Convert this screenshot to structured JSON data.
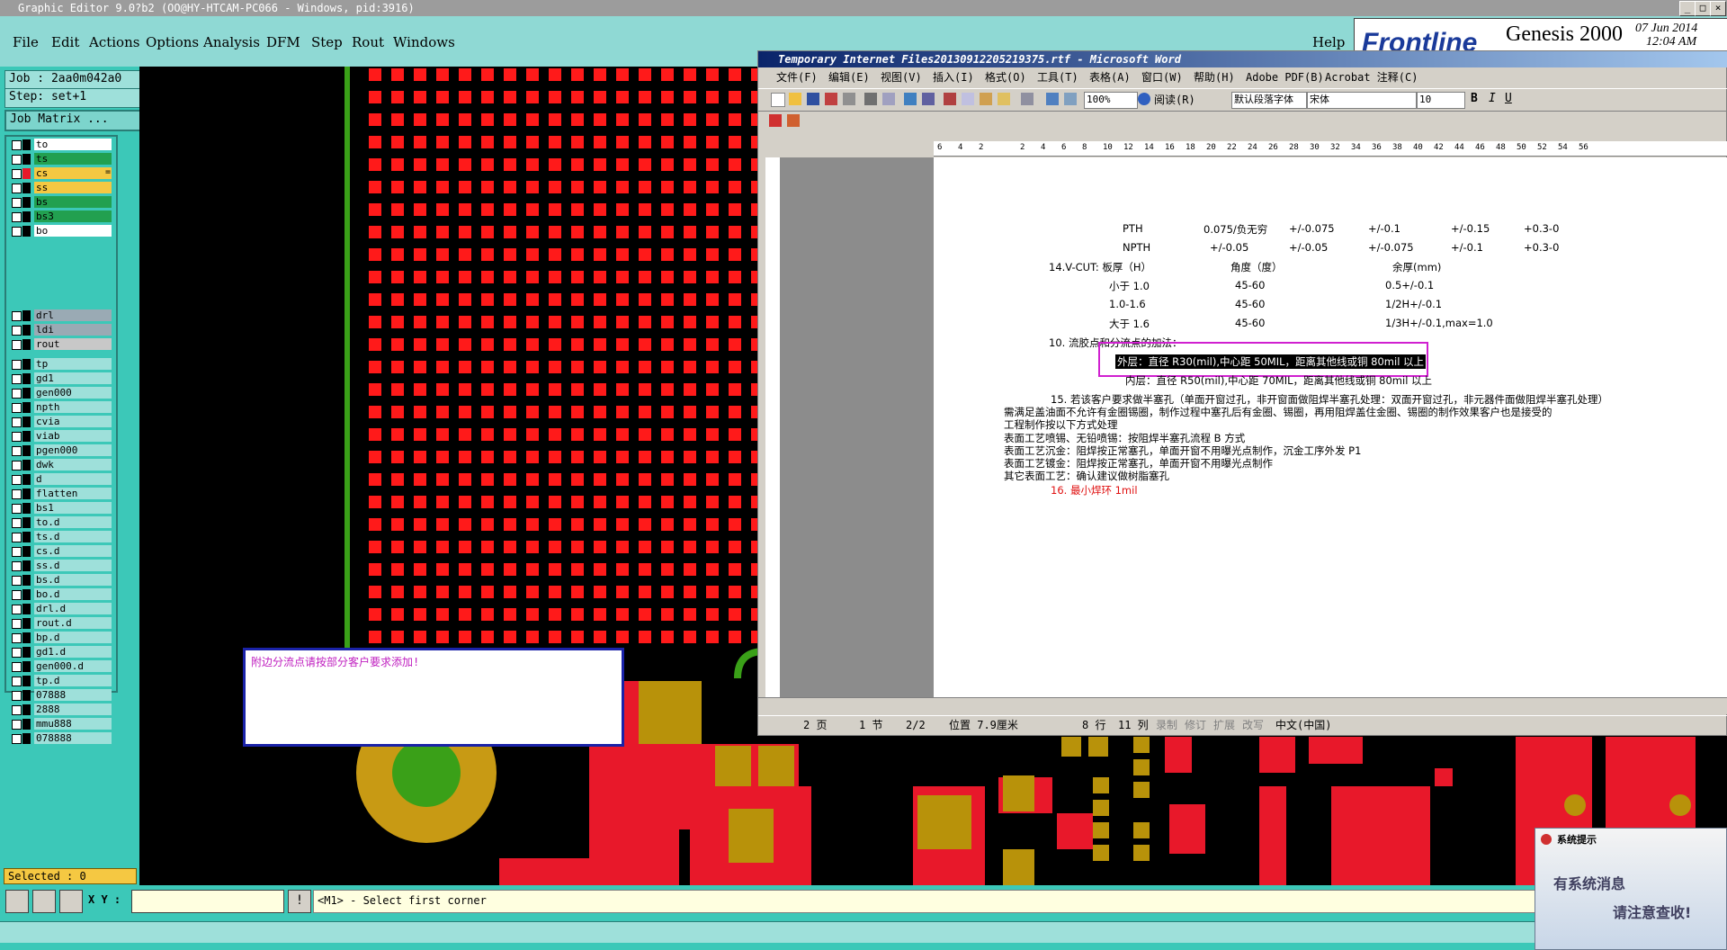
{
  "genesis": {
    "title": "Graphic Editor 9.0?b2 (OO@HY-HTCAM-PC066 - Windows, pid:3916)",
    "menus": [
      "File",
      "Edit",
      "Actions",
      "Options",
      "Analysis",
      "DFM",
      "Step",
      "Rout",
      "Windows"
    ],
    "help": "Help",
    "brand": "Frontline",
    "product": "Genesis 2000",
    "date": "07 Jun 2014",
    "time": "12:04 AM",
    "job": "Job : 2aa0m042a0",
    "step": "Step: set+1",
    "job_matrix": "Job Matrix ...",
    "selected": "Selected : 0",
    "xy_label": "X Y :",
    "status_msg": "<M1> - Select first corner",
    "layers": [
      {
        "name": "to",
        "color": "#ffffff"
      },
      {
        "name": "ts",
        "color": "#22a050"
      },
      {
        "name": "cs",
        "color": "#f5c842",
        "swatch": "#e8182a",
        "mark": "="
      },
      {
        "name": "ss",
        "color": "#f5c842"
      },
      {
        "name": "bs",
        "color": "#22a050"
      },
      {
        "name": "bs3",
        "color": "#22a050"
      },
      {
        "name": "bo",
        "color": "#ffffff"
      },
      {
        "name": "drl",
        "color": "#9aaab4"
      },
      {
        "name": "ldi",
        "color": "#9aaab4"
      },
      {
        "name": "rout",
        "color": "#c8c8c8"
      },
      {
        "name": "tp",
        "color": "#9ee0da"
      },
      {
        "name": "gd1",
        "color": "#9ee0da"
      },
      {
        "name": "gen000",
        "color": "#9ee0da"
      },
      {
        "name": "npth",
        "color": "#9ee0da"
      },
      {
        "name": "cvia",
        "color": "#9ee0da"
      },
      {
        "name": "viab",
        "color": "#9ee0da"
      },
      {
        "name": "pgen000",
        "color": "#9ee0da"
      },
      {
        "name": "dwk",
        "color": "#9ee0da"
      },
      {
        "name": "d",
        "color": "#9ee0da"
      },
      {
        "name": "flatten",
        "color": "#9ee0da"
      },
      {
        "name": "bs1",
        "color": "#9ee0da"
      },
      {
        "name": "to.d",
        "color": "#9ee0da"
      },
      {
        "name": "ts.d",
        "color": "#9ee0da"
      },
      {
        "name": "cs.d",
        "color": "#9ee0da"
      },
      {
        "name": "ss.d",
        "color": "#9ee0da"
      },
      {
        "name": "bs.d",
        "color": "#9ee0da"
      },
      {
        "name": "bo.d",
        "color": "#9ee0da"
      },
      {
        "name": "drl.d",
        "color": "#9ee0da"
      },
      {
        "name": "rout.d",
        "color": "#9ee0da"
      },
      {
        "name": "bp.d",
        "color": "#9ee0da"
      },
      {
        "name": "gd1.d",
        "color": "#9ee0da"
      },
      {
        "name": "gen000.d",
        "color": "#9ee0da"
      },
      {
        "name": "tp.d",
        "color": "#9ee0da"
      },
      {
        "name": "07888",
        "color": "#9ee0da"
      },
      {
        "name": "2888",
        "color": "#9ee0da"
      },
      {
        "name": "mmu888",
        "color": "#9ee0da"
      },
      {
        "name": "078888",
        "color": "#9ee0da"
      }
    ],
    "note": "附边分流点请按部分客户要求添加!"
  },
  "word": {
    "title": "Temporary Internet Files20130912205219375.rtf - Microsoft Word",
    "menus": [
      "文件(F)",
      "编辑(E)",
      "视图(V)",
      "插入(I)",
      "格式(O)",
      "工具(T)",
      "表格(A)",
      "窗口(W)",
      "帮助(H)",
      "Adobe PDF(B)",
      "Acrobat 注释(C)"
    ],
    "zoom": "100%",
    "read_label": "阅读(R)",
    "style": "默认段落字体",
    "font": "宋体",
    "size": "10",
    "ruler_ticks": [
      "6",
      "4",
      "2",
      "",
      "2",
      "4",
      "6",
      "8",
      "10",
      "12",
      "14",
      "16",
      "18",
      "20",
      "22",
      "24",
      "26",
      "28",
      "30",
      "32",
      "34",
      "36",
      "38",
      "40",
      "42",
      "44",
      "46",
      "48",
      "50",
      "52",
      "54",
      "56"
    ],
    "lines": {
      "pth": [
        "PTH",
        "0.075/负无穷",
        "+/-0.075",
        "+/-0.1",
        "+/-0.15",
        "+0.3-0"
      ],
      "npth": [
        "NPTH",
        "+/-0.05",
        "+/-0.05",
        "+/-0.075",
        "+/-0.1",
        "+0.3-0"
      ],
      "vcut_head": [
        "14.V-CUT:  板厚（H）",
        "角度（度）",
        "余厚(mm)"
      ],
      "vcut1": [
        "小于 1.0",
        "45-60",
        "0.5+/-0.1"
      ],
      "vcut2": [
        "1.0-1.6",
        "45-60",
        "1/2H+/-0.1"
      ],
      "vcut3": [
        "大于 1.6",
        "45-60",
        "1/3H+/-0.1,max=1.0"
      ],
      "l10": "10. 流胶点和分流点的加法：",
      "outer": "外层：直径 R30(mil),中心距 50MIL，距离其他线或铜 80mil 以上",
      "inner": "内层：直径 R50(mil),中心距 70MIL，距离其他线或铜 80mil 以上",
      "l15": "15. 若该客户要求做半塞孔（单面开窗过孔，非开窗面做阻焊半塞孔处理：双面开窗过孔，非元器件面做阻焊半塞孔处理）",
      "l15b": "需满足盖油面不允许有金圈锡圈，制作过程中塞孔后有金圈、锡圈，再用阻焊盖住金圈、锡圈的制作效果客户也是接受的",
      "l15c": "工程制作按以下方式处理",
      "l15d": "表面工艺喷锡、无铅喷锡：按阻焊半塞孔流程 B 方式",
      "l15e": "表面工艺沉金：阻焊按正常塞孔，单面开窗不用曝光点制作，沉金工序外发 P1",
      "l15f": "表面工艺镀金：阻焊按正常塞孔，单面开窗不用曝光点制作",
      "l15g": "其它表面工艺：确认建议做树脂塞孔",
      "l16": "16. 最小焊环 1mil"
    },
    "status": {
      "page": "2 页",
      "section": "1 节",
      "pages": "2/2",
      "pos": "位置 7.9厘米",
      "row": "8 行",
      "col": "11 列",
      "rec": "录制",
      "trk": "修订",
      "ext": "扩展",
      "ovr": "改写",
      "lang": "中文(中国)"
    }
  },
  "popup": {
    "title": "系统提示",
    "line1": "有系统消息",
    "line2": "请注意查收!"
  }
}
